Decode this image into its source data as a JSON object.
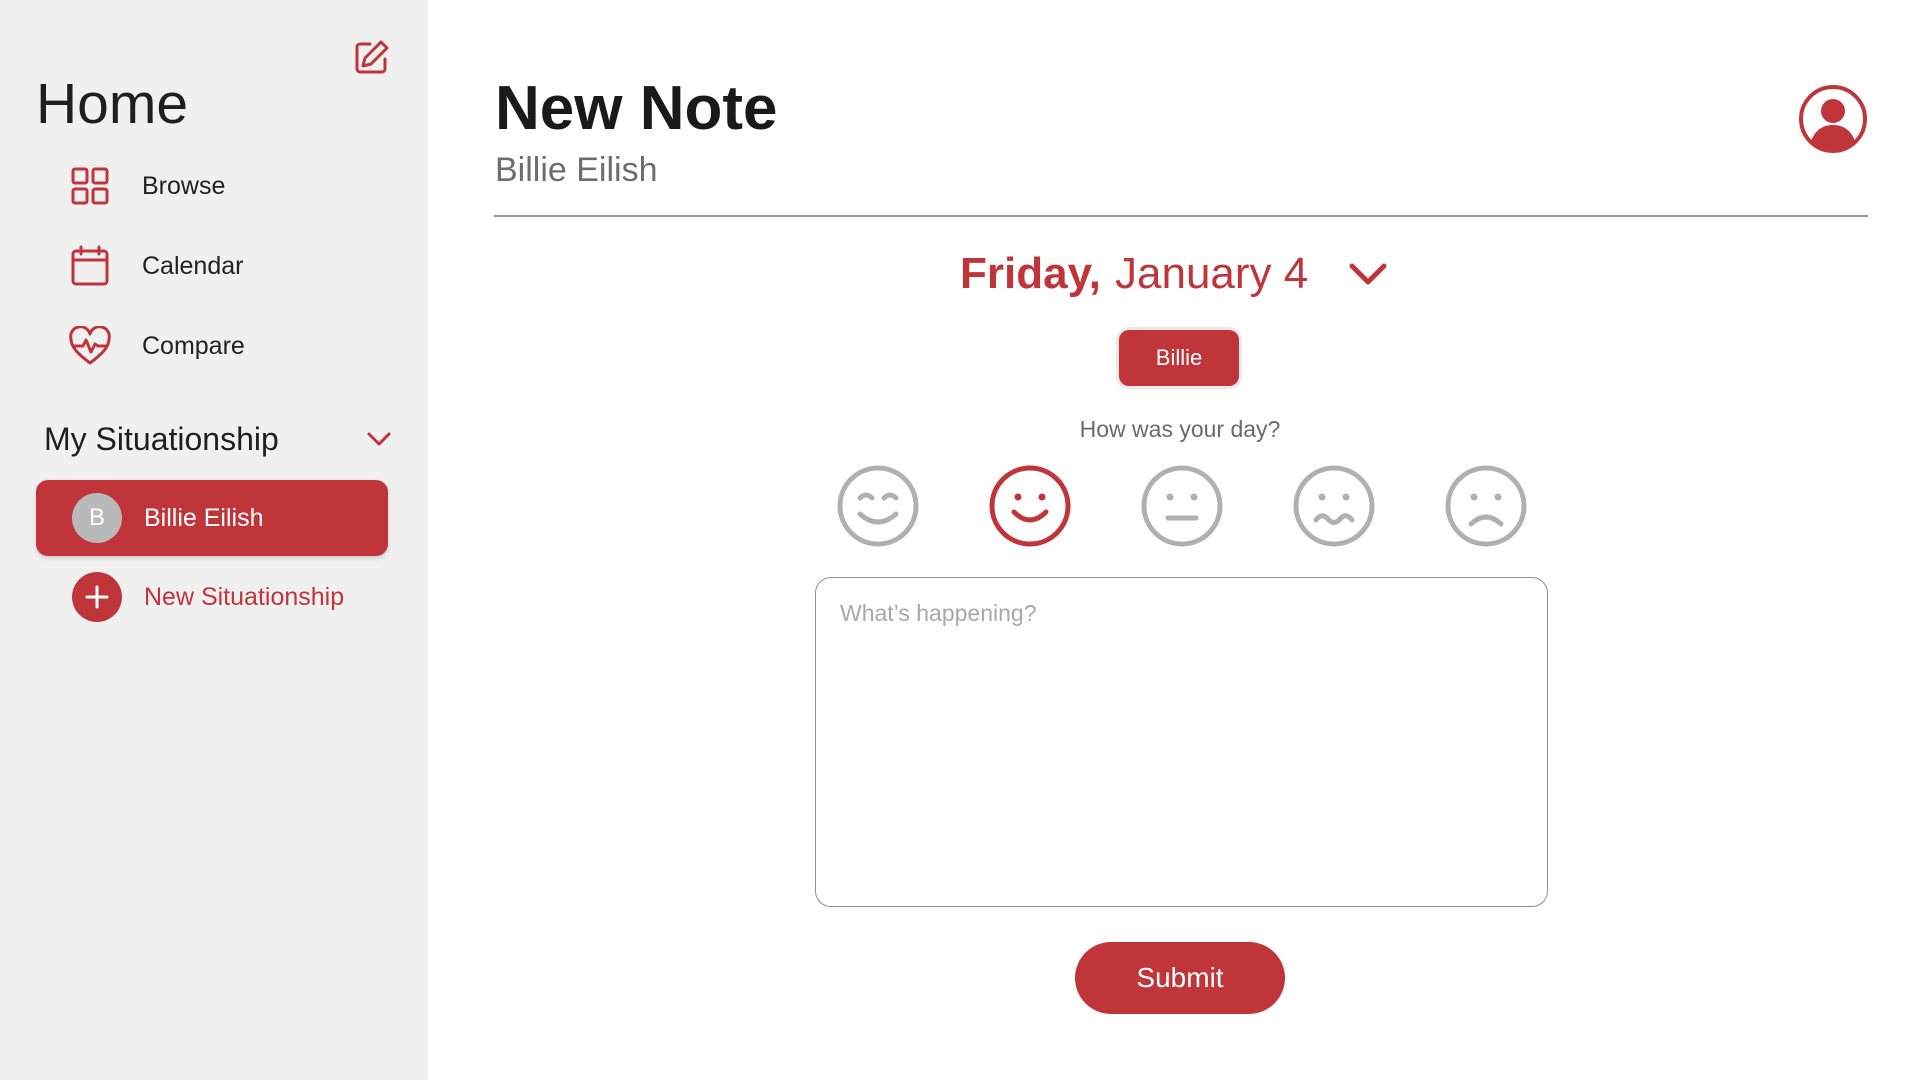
{
  "sidebar": {
    "title": "Home",
    "nav": [
      {
        "label": "Browse",
        "icon": "grid-icon"
      },
      {
        "label": "Calendar",
        "icon": "calendar-icon"
      },
      {
        "label": "Compare",
        "icon": "heart-pulse-icon"
      }
    ],
    "section_label": "My Situationship",
    "active_item": {
      "initial": "B",
      "label": "Billie Eilish"
    },
    "new_item_label": "New Situationship"
  },
  "main": {
    "title": "New Note",
    "subtitle": "Billie Eilish",
    "date_day": "Friday,",
    "date_rest": "January 4",
    "tag_label": "Billie",
    "question": "How was your day?",
    "moods": [
      "very-happy",
      "happy",
      "neutral",
      "uneasy",
      "sad"
    ],
    "selected_mood": "happy",
    "note_placeholder": "What’s happening?",
    "submit_label": "Submit"
  },
  "colors": {
    "accent": "#c0353a",
    "sidebar_bg": "#f0f0f0",
    "mood_inactive": "#b0b0b0"
  }
}
